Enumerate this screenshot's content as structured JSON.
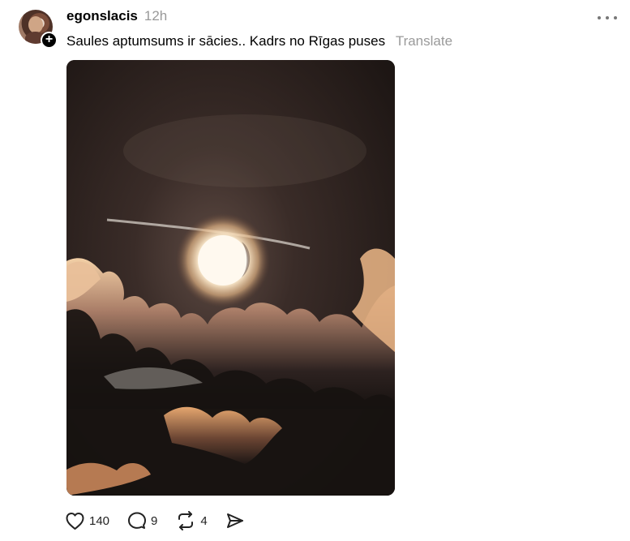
{
  "post": {
    "username": "egonslacis",
    "timestamp": "12h",
    "caption": "Saules aptumsums ir sācies.. Kadrs no Rīgas puses",
    "translate_label": "Translate",
    "image_alt": "Saules aptumsums ir sācies.. Kadrs no Rīgas puses"
  },
  "actions": {
    "likes": "140",
    "comments": "9",
    "reposts": "4"
  },
  "icons": {
    "avatar": "avatar",
    "follow": "plus-icon",
    "more": "more-icon",
    "like": "heart-icon",
    "comment": "comment-icon",
    "repost": "repost-icon",
    "share": "send-icon"
  },
  "colors": {
    "text": "#000000",
    "muted": "#999999",
    "icon": "#222222",
    "photo_dark": "#241b18",
    "sun": "#fff3dc",
    "cloud_light": "#e9b985"
  }
}
